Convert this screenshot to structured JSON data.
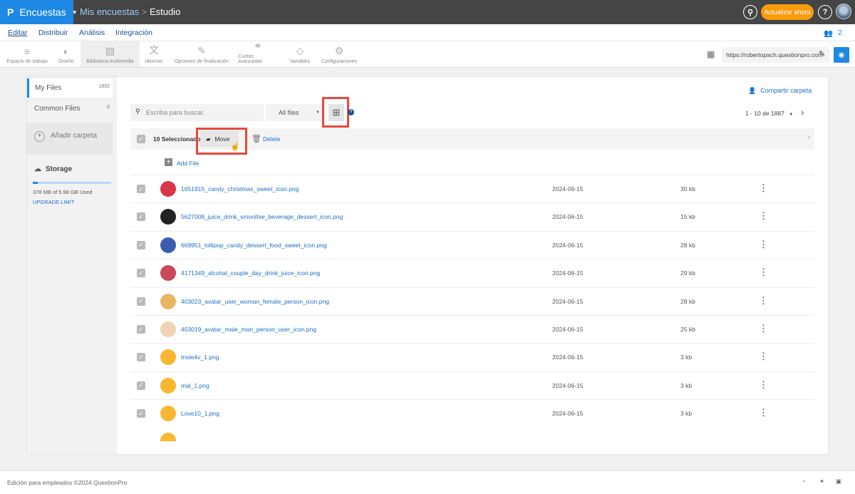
{
  "header": {
    "app": "Encuestas",
    "breadcrumb_parent": "Mis encuestas",
    "breadcrumb_sep": ">",
    "breadcrumb_current": "Estudio",
    "upgrade": "Actualizar ahora",
    "help": "?"
  },
  "tabs": [
    "Editar",
    "Distribuir",
    "Análisis",
    "Integración"
  ],
  "collaborators": "2",
  "toolbar": [
    {
      "label": "Espacio de trabajo",
      "icon": "≡"
    },
    {
      "label": "Diseño",
      "icon": "◐"
    },
    {
      "label": "Biblioteca multimedia",
      "icon": "▨"
    },
    {
      "label": "Idiomas",
      "icon": "文"
    },
    {
      "label": "Opciones de finalización",
      "icon": "✎"
    },
    {
      "label": "Cuotas avanzadas",
      "icon": "⚭"
    },
    {
      "label": "Variables",
      "icon": "◇"
    },
    {
      "label": "Configuraciones",
      "icon": "⚙"
    }
  ],
  "survey_url": "https://robertopach.questionpro.com",
  "sidebar": {
    "my_files": "My Files",
    "my_files_count": "1892",
    "common_files": "Common Files",
    "common_files_count": "0",
    "add_folder": "Añadir carpeta",
    "storage_title": "Storage",
    "storage_used": "378 MB of 5.98 GB Used",
    "storage_fraction": 0.063,
    "upgrade_limit": "UPGRADE LIMIT"
  },
  "main": {
    "share_folder": "Compartir carpeta",
    "search_placeholder": "Escriba para buscar.",
    "filter": "All files",
    "pagination": "1 - 10 de 1887",
    "selected": "10 Seleccionado",
    "move": "Move",
    "delete": "Delete",
    "add_file": "Add File"
  },
  "files": [
    {
      "name": "1651915_candy_christmas_sweet_icon.png",
      "date": "2024-06-15",
      "size": "30 kb",
      "color": "#d8364b"
    },
    {
      "name": "5627008_juice_drink_smoothie_beverage_dessert_icon.png",
      "date": "2024-06-15",
      "size": "15 kb",
      "color": "#222222"
    },
    {
      "name": "669951_lollipop_candy_dessert_food_sweet_icon.png",
      "date": "2024-06-15",
      "size": "28 kb",
      "color": "#3a5db0"
    },
    {
      "name": "4171349_alcohal_couple_day_drink_juice_icon.png",
      "date": "2024-06-15",
      "size": "29 kb",
      "color": "#c94a5a"
    },
    {
      "name": "403023_avatar_user_woman_female_person_icon.png",
      "date": "2024-06-15",
      "size": "28 kb",
      "color": "#e9b563"
    },
    {
      "name": "403019_avatar_male_man_person_user_icon.png",
      "date": "2024-06-15",
      "size": "25 kb",
      "color": "#f1d2b4"
    },
    {
      "name": "triste4v_1.png",
      "date": "2024-06-15",
      "size": "3 kb",
      "color": "#f7b731"
    },
    {
      "name": "mal_1.png",
      "date": "2024-06-15",
      "size": "3 kb",
      "color": "#f7b731"
    },
    {
      "name": "Love10_1.png",
      "date": "2024-06-15",
      "size": "3 kb",
      "color": "#f7b731"
    }
  ],
  "footer": "Edición para empleados ©2024 QuestionPro"
}
